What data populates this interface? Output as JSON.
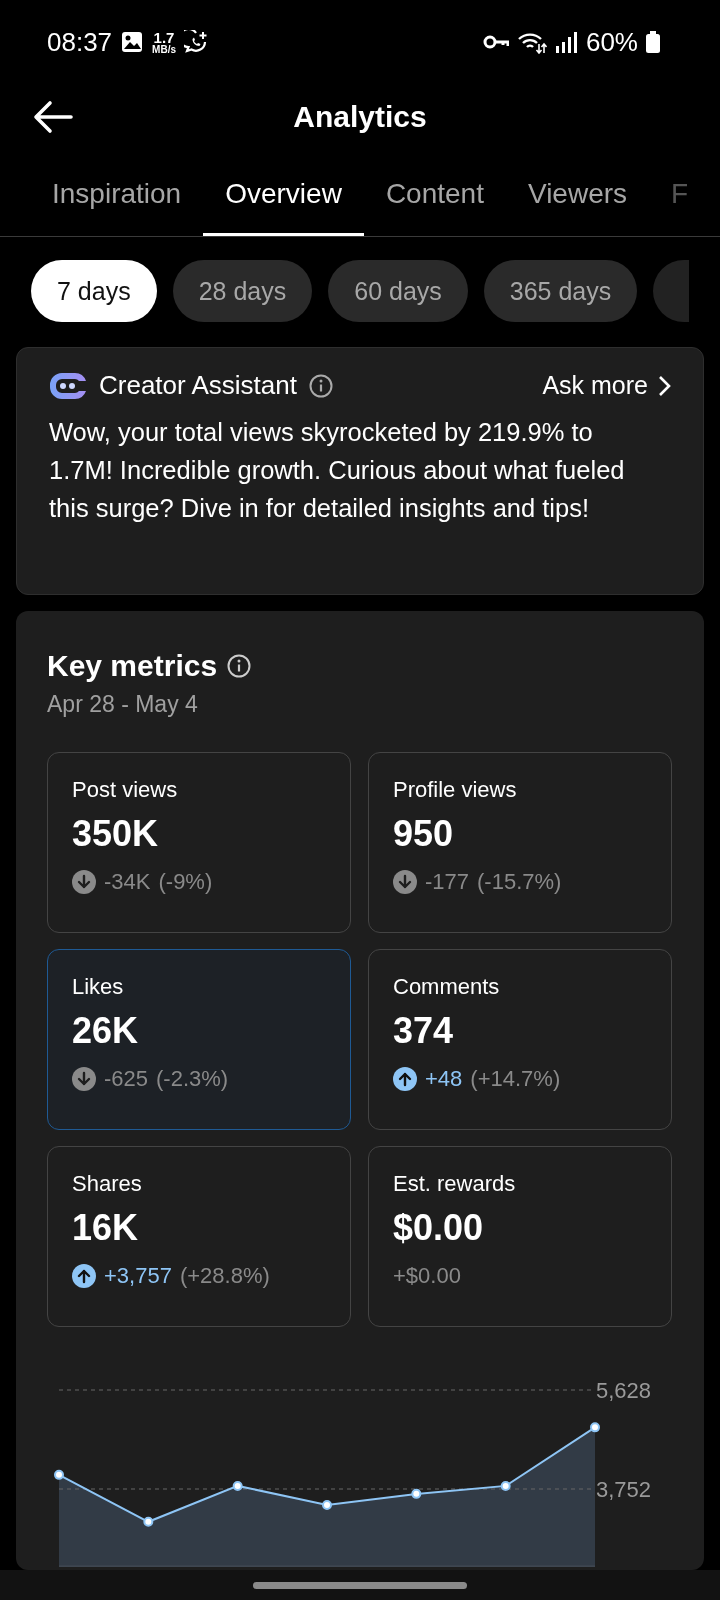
{
  "status_bar": {
    "time": "08:37",
    "speed": "1.7",
    "speed_unit": "MB/s",
    "battery": "60%"
  },
  "header": {
    "title": "Analytics"
  },
  "tabs": [
    {
      "label": "Inspiration",
      "selected": false
    },
    {
      "label": "Overview",
      "selected": true
    },
    {
      "label": "Content",
      "selected": false
    },
    {
      "label": "Viewers",
      "selected": false
    },
    {
      "label": "F",
      "selected": false
    }
  ],
  "ranges": [
    {
      "label": "7 days",
      "selected": true
    },
    {
      "label": "28 days",
      "selected": false
    },
    {
      "label": "60 days",
      "selected": false
    },
    {
      "label": "365 days",
      "selected": false
    }
  ],
  "assistant": {
    "title": "Creator Assistant",
    "link": "Ask more",
    "message": "Wow, your total views skyrocketed by 219.9% to 1.7M! Incredible growth. Curious about what fueled this surge? Dive in for detailed insights and tips!"
  },
  "key_metrics": {
    "title": "Key metrics",
    "period": "Apr 28 - May 4",
    "metrics": [
      {
        "label": "Post views",
        "value": "350K",
        "change": "-34K",
        "change_pct": "(-9%)",
        "kind": "down",
        "selected": false
      },
      {
        "label": "Profile views",
        "value": "950",
        "change": "-177",
        "change_pct": "(-15.7%)",
        "kind": "down",
        "selected": false
      },
      {
        "label": "Likes",
        "value": "26K",
        "change": "-625",
        "change_pct": "(-2.3%)",
        "kind": "down",
        "selected": true
      },
      {
        "label": "Comments",
        "value": "374",
        "change": "+48",
        "change_pct": "(+14.7%)",
        "kind": "up",
        "selected": false
      },
      {
        "label": "Shares",
        "value": "16K",
        "change": "+3,757",
        "change_pct": "(+28.8%)",
        "kind": "up",
        "selected": false
      },
      {
        "label": "Est. rewards",
        "value": "$0.00",
        "change": "+$0.00",
        "kind": "flat",
        "selected": false
      }
    ],
    "chart_data": {
      "type": "area",
      "categories": [
        null,
        null,
        null,
        null,
        null,
        null,
        null
      ],
      "ylim": [
        2270,
        5628
      ],
      "series": [
        {
          "color": "#8ec5f5",
          "values": [
            4020,
            3130,
            3810,
            3450,
            3660,
            3810,
            4920
          ]
        }
      ],
      "yticks": [
        {
          "value": 3752,
          "label": "3,752"
        },
        {
          "value": 5628,
          "label": "5,628"
        }
      ]
    }
  }
}
